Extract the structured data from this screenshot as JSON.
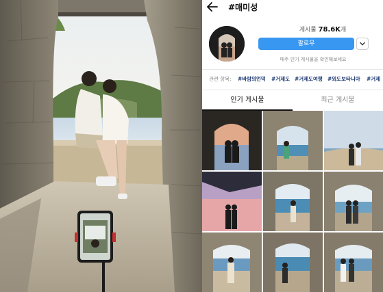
{
  "header": {
    "hashtag": "#매미성"
  },
  "stats": {
    "label": "게시물",
    "count": "78.6K",
    "suffix": "개"
  },
  "buttons": {
    "follow": "팔로우"
  },
  "notice": "매주 인기 게시물을 확인해보세요",
  "related": {
    "label": "관련 항목:",
    "tags": [
      "#바람의언덕",
      "#거제도",
      "#거제도여행",
      "#외도보타니아",
      "#거제"
    ]
  },
  "tabs": [
    "인기 게시물",
    "최근 게시물"
  ],
  "icons": [
    "back-arrow-icon",
    "chevron-down-icon"
  ],
  "colors": {
    "follow": "#3897f0",
    "tag": "#1f3b73"
  }
}
